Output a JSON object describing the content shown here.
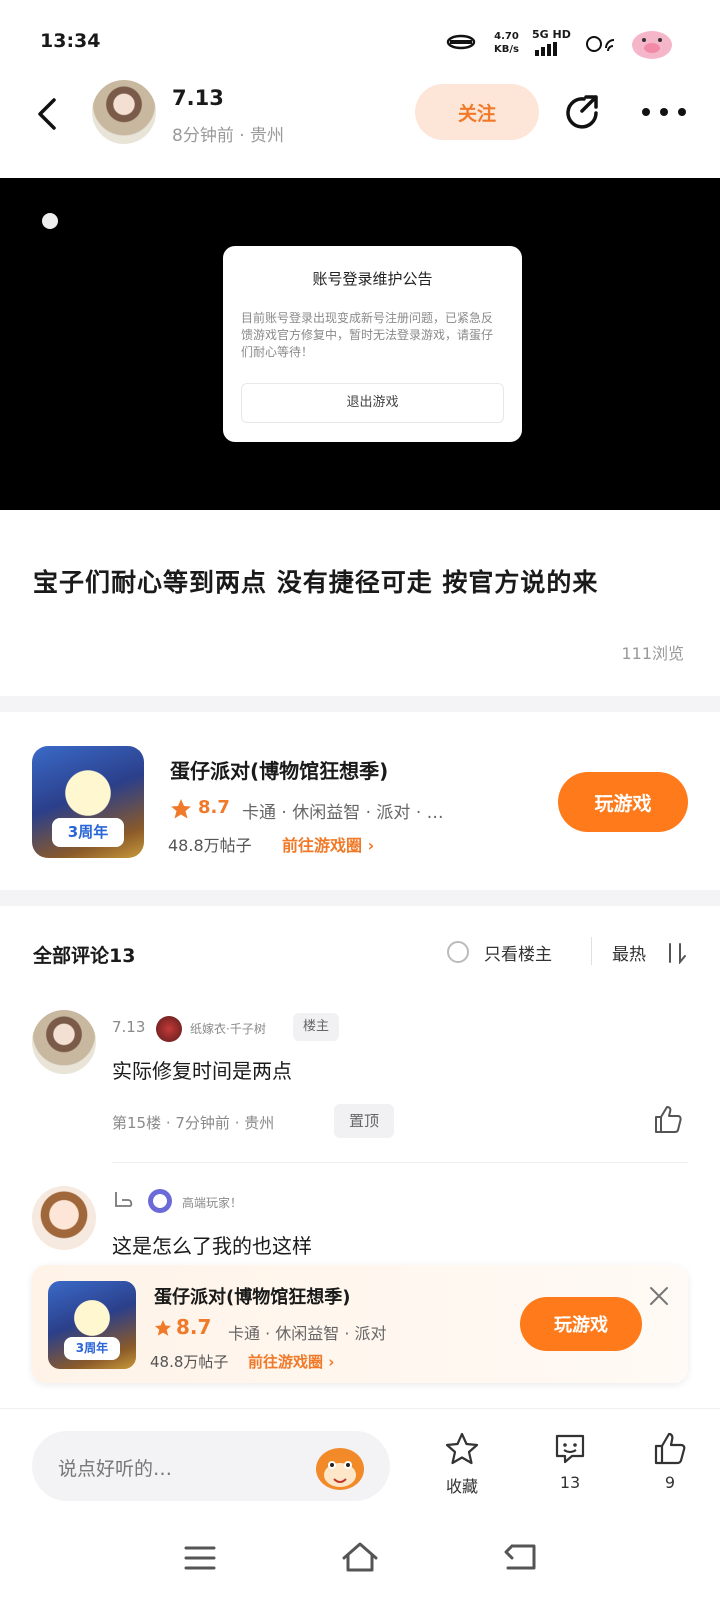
{
  "status": {
    "time": "13:34",
    "net_speed": "4.70",
    "net_unit": "KB/s",
    "signal": "5G HD"
  },
  "header": {
    "author": "7.13",
    "meta": "8分钟前 · 贵州",
    "follow": "关注"
  },
  "video_dialog": {
    "title": "账号登录维护公告",
    "body": "目前账号登录出现变成新号注册问题，已紧急反馈游戏官方修复中，暂时无法登录游戏，请蛋仔们耐心等待！",
    "button": "退出游戏"
  },
  "post": {
    "text": "宝子们耐心等到两点 没有捷径可走 按官方说的来",
    "views": "111浏览"
  },
  "game": {
    "title": "蛋仔派对(博物馆狂想季)",
    "rating": "8.7",
    "tags": "卡通 · 休闲益智 · 派对 · …",
    "posts": "48.8万帖子",
    "goto": "前往游戏圈",
    "play": "玩游戏",
    "badge": "3周年"
  },
  "comments_header": {
    "title": "全部评论13",
    "only_op": "只看楼主",
    "sort": "最热"
  },
  "comments": [
    {
      "name": "7.13",
      "medal": "纸嫁衣·千子树",
      "op_tag": "楼主",
      "text": "实际修复时间是两点",
      "meta": "第15楼 · 7分钟前 · 贵州",
      "pin": "置顶"
    },
    {
      "name": "高端玩家！",
      "text": "这是怎么了我的也这样"
    }
  ],
  "floating_card": {
    "title": "蛋仔派对(博物馆狂想季)",
    "rating": "8.7",
    "tags": "卡通 · 休闲益智 · 派对",
    "posts": "48.8万帖子",
    "goto": "前往游戏圈",
    "play": "玩游戏"
  },
  "bottom_bar": {
    "placeholder": "说点好听的…",
    "favorite": "收藏",
    "comments": "13",
    "likes": "9"
  },
  "colors": {
    "accent": "#ff7a1a",
    "follow_bg": "#fde6d8",
    "muted": "#9a9a9a"
  }
}
